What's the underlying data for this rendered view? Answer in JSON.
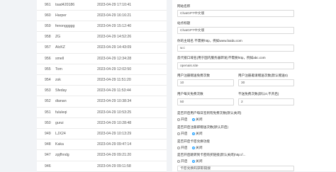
{
  "users": [
    {
      "id": "961",
      "name": "tsad420186",
      "time": "2023-04-29 17:10:41"
    },
    {
      "id": "960",
      "name": "Harper",
      "time": "2023-04-29 16:16:21"
    },
    {
      "id": "959",
      "name": "fenonggggg",
      "time": "2023-04-29 15:12:40"
    },
    {
      "id": "958",
      "name": "ZG",
      "time": "2023-04-29 14:52:26"
    },
    {
      "id": "957",
      "name": "AlcKZ",
      "time": "2023-04-29 14:43:09"
    },
    {
      "id": "956",
      "name": "smell",
      "time": "2023-04-29 12:34:28"
    },
    {
      "id": "955",
      "name": "Tom",
      "time": "2023-04-29 12:02:50"
    },
    {
      "id": "954",
      "name": "zsk",
      "time": "2023-04-29 11:51:20"
    },
    {
      "id": "953",
      "name": "Sfeday",
      "time": "2023-04-29 11:53:44"
    },
    {
      "id": "952",
      "name": "dianan",
      "time": "2023-04-29 10:38:34"
    },
    {
      "id": "951",
      "name": "fululeqi",
      "time": "2023-04-29 10:53:25"
    },
    {
      "id": "950",
      "name": "gurui",
      "time": "2023-04-29 10:28:48"
    },
    {
      "id": "949",
      "name": "LJX24",
      "time": "2023-04-29 10:13:29"
    },
    {
      "id": "948",
      "name": "Kaka",
      "time": "2023-04-29 09:47:14"
    },
    {
      "id": "947",
      "name": "zpjfhndg",
      "time": "2023-04-29 09:21:20"
    },
    {
      "id": "946",
      "name": "",
      "time": "2023-04-29 09:11:58"
    }
  ],
  "settings": {
    "site_name_label": "网站名称",
    "site_name_value": "ChatGPT中文版",
    "site_title_label": "站点标题",
    "site_title_value": "ChatGPT中文版",
    "domain_label": "你的主域名 不需要http，例如www.baidu.com",
    "domain_value": "w.c",
    "api_label": "反代接口域名(用于国内服务器转发)不需要http，例如abc.com",
    "api_value": "openais.site",
    "reg_free_label": "用户注册赠送免费次数",
    "reg_free_value": "10",
    "invite_label": "用户注册邀请赠送次数(默认赠送0)",
    "invite_value": "30",
    "daily_free_label": "用户每天免费次数",
    "daily_free_value": "50",
    "limit_label": "不送免费次数(默认0,不开启)",
    "limit_value": "2",
    "toggle1_label": "是否开启用户每日签到有免费次数(默认关闭)",
    "toggle2_label": "是否开启注册即赠送次数(默认开启)",
    "toggle3_label": "是否开启卡密兑换功能",
    "toggle4_label": "是否开启跳转到卡密购买链接(默认关闭)http://...",
    "on_label": "开启",
    "off_label": "关闭",
    "card_label": "卡密兑换码获取地址",
    "card_value": "卡密兑换码获取链接"
  }
}
